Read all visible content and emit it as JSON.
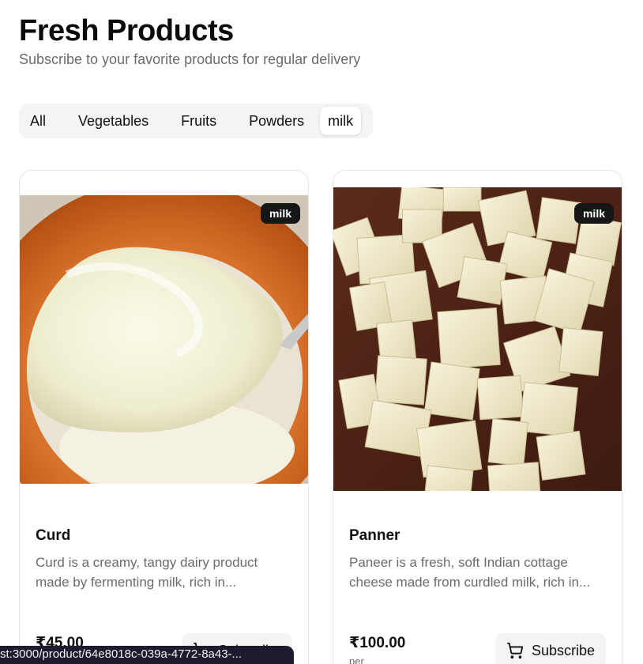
{
  "header": {
    "title": "Fresh Products",
    "subtitle": "Subscribe to your favorite products for regular delivery"
  },
  "tabs": [
    {
      "label": "All",
      "active": false
    },
    {
      "label": "Vegetables",
      "active": false
    },
    {
      "label": "Fruits",
      "active": false
    },
    {
      "label": "Powders",
      "active": false
    },
    {
      "label": "milk",
      "active": true
    }
  ],
  "products": [
    {
      "name": "Curd",
      "badge": "milk",
      "description": "Curd is a creamy, tangy dairy product made by fermenting milk, rich in...",
      "price": "₹45.00",
      "per": "",
      "subscribe_label": "Subscribe",
      "image": "curd-in-clay-bowl"
    },
    {
      "name": "Panner",
      "badge": "milk",
      "description": "Paneer is a fresh, soft Indian cottage cheese made from curdled milk, rich in...",
      "price": "₹100.00",
      "per": "per",
      "subscribe_label": "Subscribe",
      "image": "paneer-cubes-on-board"
    }
  ],
  "status_bar": {
    "url": "st:3000/product/64e8018c-039a-4772-8a43-..."
  },
  "icons": {
    "cart": "cart-icon"
  }
}
